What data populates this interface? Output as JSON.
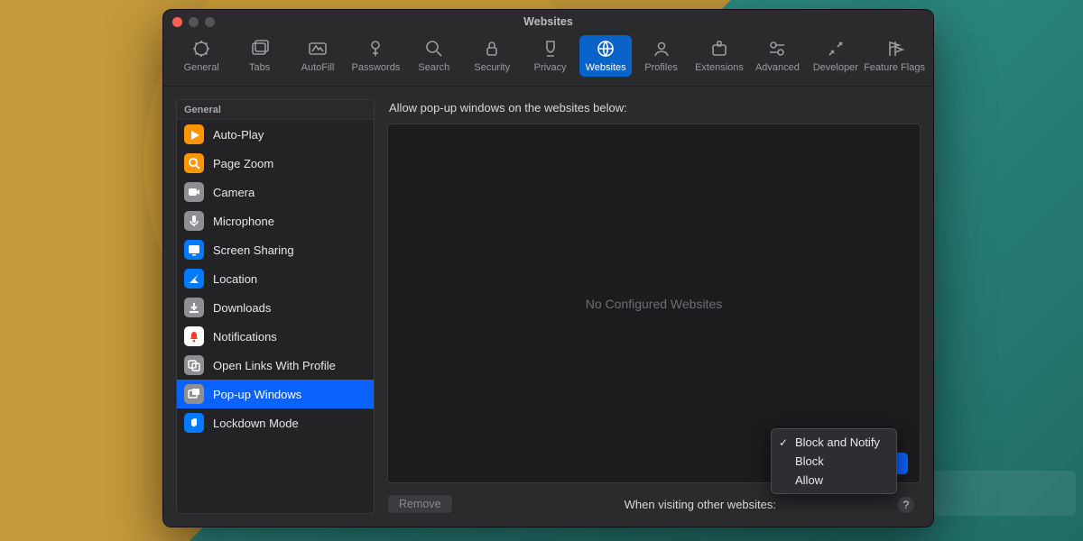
{
  "window": {
    "title": "Websites"
  },
  "toolbar": [
    {
      "id": "general",
      "label": "General"
    },
    {
      "id": "tabs",
      "label": "Tabs"
    },
    {
      "id": "autofill",
      "label": "AutoFill"
    },
    {
      "id": "passwords",
      "label": "Passwords"
    },
    {
      "id": "search",
      "label": "Search"
    },
    {
      "id": "security",
      "label": "Security"
    },
    {
      "id": "privacy",
      "label": "Privacy"
    },
    {
      "id": "websites",
      "label": "Websites",
      "active": true
    },
    {
      "id": "profiles",
      "label": "Profiles"
    },
    {
      "id": "extensions",
      "label": "Extensions"
    },
    {
      "id": "advanced",
      "label": "Advanced"
    },
    {
      "id": "developer",
      "label": "Developer"
    },
    {
      "id": "featureflags",
      "label": "Feature Flags"
    }
  ],
  "sidebar": {
    "section": "General",
    "items": [
      {
        "label": "Auto-Play",
        "icon": "play",
        "color": "#ff9500"
      },
      {
        "label": "Page Zoom",
        "icon": "zoom",
        "color": "#ff9500"
      },
      {
        "label": "Camera",
        "icon": "camera",
        "color": "#8e8e93"
      },
      {
        "label": "Microphone",
        "icon": "mic",
        "color": "#8e8e93"
      },
      {
        "label": "Screen Sharing",
        "icon": "screen",
        "color": "#007aff"
      },
      {
        "label": "Location",
        "icon": "location",
        "color": "#007aff"
      },
      {
        "label": "Downloads",
        "icon": "download",
        "color": "#8e8e93"
      },
      {
        "label": "Notifications",
        "icon": "bell",
        "color": "#ffffff"
      },
      {
        "label": "Open Links With Profile",
        "icon": "link",
        "color": "#8e8e93"
      },
      {
        "label": "Pop-up Windows",
        "icon": "popup",
        "color": "#8e8e93",
        "selected": true
      },
      {
        "label": "Lockdown Mode",
        "icon": "hand",
        "color": "#007aff"
      }
    ]
  },
  "main": {
    "heading": "Allow pop-up windows on the websites below:",
    "empty_text": "No Configured Websites",
    "remove_label": "Remove",
    "other_label": "When visiting other websites:"
  },
  "dropdown": {
    "options": [
      {
        "label": "Block and Notify",
        "checked": true
      },
      {
        "label": "Block"
      },
      {
        "label": "Allow"
      }
    ]
  },
  "help": {
    "label": "?"
  }
}
